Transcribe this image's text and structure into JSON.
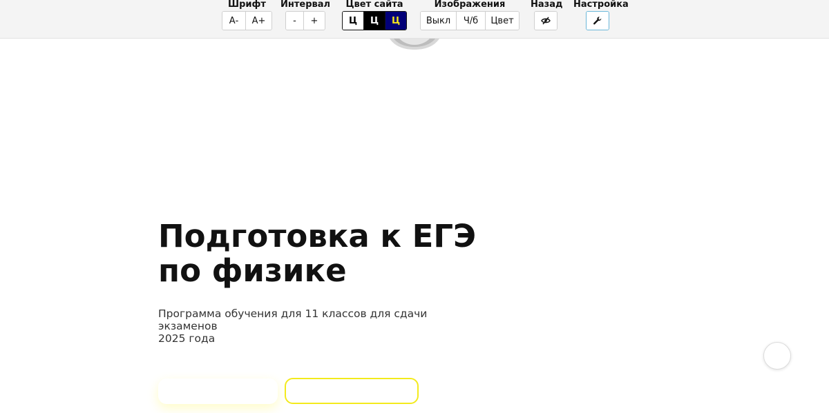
{
  "accessibility_panel": {
    "font": {
      "title": "Шрифт",
      "decrease_label": "А-",
      "increase_label": "А+"
    },
    "interval": {
      "title": "Интервал",
      "decrease_label": "-",
      "increase_label": "+"
    },
    "site_color": {
      "title": "Цвет сайта",
      "white_label": "Ц",
      "black_label": "Ц",
      "blue_label": "Ц",
      "colors": {
        "white_bg": "#ffffff",
        "black_bg": "#000000",
        "blue_bg": "#020078",
        "blue_text": "#f7e61b"
      }
    },
    "images": {
      "title": "Изображения",
      "off_label": "Выкл",
      "bw_label": "Ч/б",
      "color_label": "Цвет"
    },
    "back": {
      "title": "Назад",
      "icon": "eye-slash-icon"
    },
    "settings": {
      "title": "Настройка",
      "icon": "wrench-icon"
    }
  },
  "hero": {
    "title_line1": "Подготовка к ЕГЭ",
    "title_line2": "по физике",
    "subtitle_line1": "Программа обучения для 11 классов для сдачи экзаменов",
    "subtitle_line2": "2025 года"
  },
  "colors": {
    "accent_yellow": "#f3ea1c",
    "panel_bg": "#f4f4f4"
  }
}
